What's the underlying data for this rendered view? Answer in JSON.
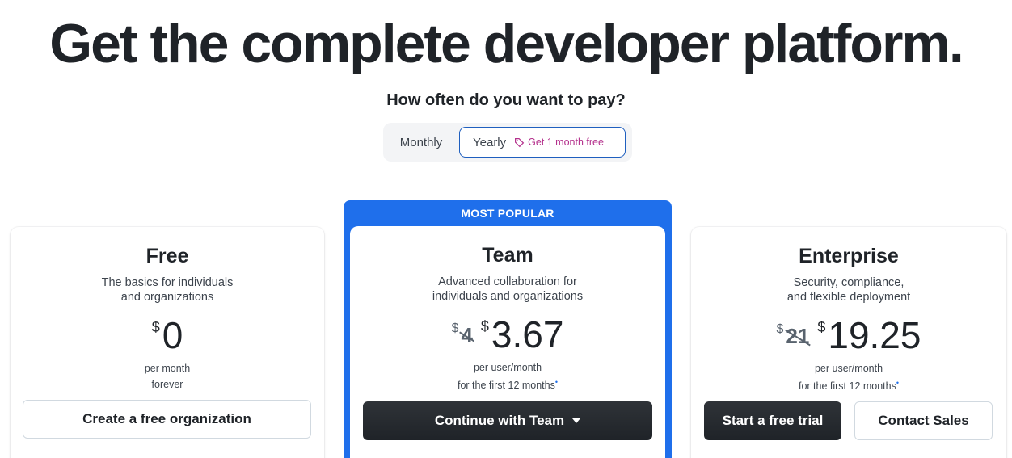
{
  "headline": "Get the complete developer platform.",
  "billing": {
    "question": "How often do you want to pay?",
    "monthly_label": "Monthly",
    "yearly_label": "Yearly",
    "yearly_tag": "Get 1 month free",
    "selected": "Yearly"
  },
  "plans": {
    "free": {
      "title": "Free",
      "desc_line1": "The basics for individuals",
      "desc_line2": "and organizations",
      "currency": "$",
      "price": "0",
      "sub1": "per month",
      "sub2": "forever",
      "cta": "Create a free organization"
    },
    "team": {
      "badge": "MOST POPULAR",
      "title": "Team",
      "desc_line1": "Advanced collaboration for",
      "desc_line2": "individuals and organizations",
      "currency": "$",
      "old_price": "4",
      "price": "3.67",
      "sub1": "per user/month",
      "sub2": "for the first 12 months",
      "cta": "Continue with Team"
    },
    "enterprise": {
      "title": "Enterprise",
      "desc_line1": "Security, compliance,",
      "desc_line2": "and flexible deployment",
      "currency": "$",
      "old_price": "21",
      "price": "19.25",
      "sub1": "per user/month",
      "sub2": "for the first 12 months",
      "cta_primary": "Start a free trial",
      "cta_secondary": "Contact Sales"
    }
  },
  "colors": {
    "accent_blue": "#1f6feb",
    "tag_pink": "#b4308c",
    "dark_button": "#1f2328"
  }
}
